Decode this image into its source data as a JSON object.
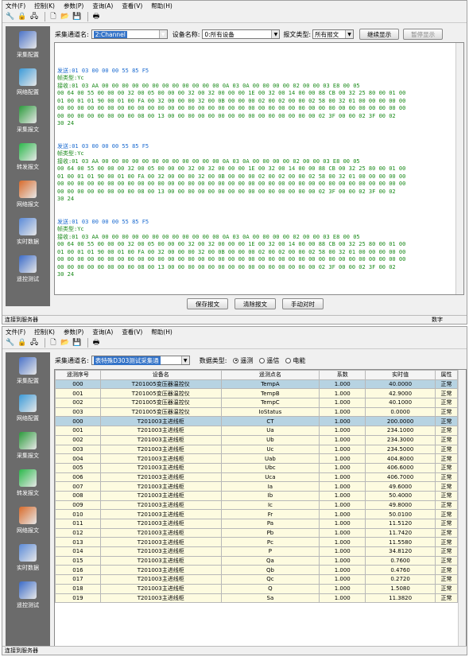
{
  "top": {
    "menu": [
      "文件(F)",
      "控制(K)",
      "参数(P)",
      "查询(A)",
      "查看(V)",
      "帮助(H)"
    ],
    "nav": [
      {
        "label": "采集配置",
        "icon": "config-icon",
        "color": "#4a72c8"
      },
      {
        "label": "网络配置",
        "icon": "network-config-icon",
        "color": "#3a9ad8"
      },
      {
        "label": "采集报文",
        "icon": "collect-message-icon",
        "color": "#2a9a3a"
      },
      {
        "label": "转发报文",
        "icon": "forward-message-icon",
        "color": "#2ab84a"
      },
      {
        "label": "网络报文",
        "icon": "network-message-icon",
        "color": "#d86a2a"
      },
      {
        "label": "实时数据",
        "icon": "realtime-data-icon",
        "color": "#5a8ad8"
      },
      {
        "label": "遥控测试",
        "icon": "remote-test-icon",
        "color": "#3a6ac8"
      }
    ],
    "channel_label": "采集通道名:",
    "channel_value": "2:Channel",
    "device_label": "设备名称:",
    "device_value": "0:所有设备",
    "type_label": "报文类型:",
    "type_value": "所有报文",
    "continue_btn": "继续显示",
    "pause_btn": "暂停显示",
    "log": [
      {
        "sent": "发送:01 03 00 00 00 55 85 F5",
        "frame": "帧类型:Yc",
        "recv": [
          "接收:01 03 AA 00 00 00 00 00 00 00 00 00 00 00 00 0A 03 0A 00 00 00 00 02 00 00 03 E8 00 05",
          "00 64 00 55 00 00 00 32 00 05 00 00 00 32 00 32 00 00 00 1E 00 32 00 14 00 00 88 CB 00 32 25 80 00 01 00",
          "01 00 01 01 90 00 01 00 FA 00 32 00 00 00 32 00 0B 00 00 00 02 00 02 00 00 02 58 00 32 01 00 00 00 00 00",
          "00 00 00 00 00 00 00 00 00 00 00 00 00 00 00 00 00 00 00 00 00 00 00 00 00 00 00 00 00 00 00 00 00 00 00",
          "00 00 00 00 00 00 00 00 08 00 13 00 00 00 00 00 00 00 00 00 00 00 00 00 00 00 02 3F 00 00 02 3F 00 02",
          "30 24"
        ]
      },
      {
        "sent": "发送:01 03 00 00 00 55 85 F5",
        "frame": "帧类型:Yc",
        "recv": [
          "接收:01 03 AA 00 00 00 00 00 00 00 00 00 00 00 00 0A 03 0A 00 00 00 00 02 00 00 03 E8 00 05",
          "00 64 00 55 00 00 00 32 00 05 00 00 00 32 00 32 00 00 00 1E 00 32 00 14 00 00 88 CB 00 32 25 80 00 01 00",
          "01 00 01 01 90 00 01 00 FA 00 32 00 00 00 32 00 0B 00 00 00 02 00 02 00 00 02 58 00 32 01 00 00 00 00 00",
          "00 00 00 00 00 00 00 00 00 00 00 00 00 00 00 00 00 00 00 00 00 00 00 00 00 00 00 00 00 00 00 00 00 00 00",
          "00 00 00 00 00 00 00 00 08 00 13 00 00 00 00 00 00 00 00 00 00 00 00 00 00 00 02 3F 00 00 02 3F 00 02",
          "30 24"
        ]
      },
      {
        "sent": "发送:01 03 00 00 00 55 85 F5",
        "frame": "帧类型:Yc",
        "recv": [
          "接收:01 03 AA 00 00 00 00 00 00 00 00 00 00 00 00 0A 03 0A 00 00 00 00 02 00 00 03 E8 00 05",
          "00 64 00 55 00 00 00 32 00 05 00 00 00 32 00 32 00 00 00 1E 00 32 00 14 00 00 88 CB 00 32 25 80 00 01 00",
          "01 00 01 01 90 00 01 00 FA 00 32 00 00 00 32 00 0B 00 00 00 02 00 02 00 00 02 58 00 32 01 00 00 00 00 00",
          "00 00 00 00 00 00 00 00 00 00 00 00 00 00 00 00 00 00 00 00 00 00 00 00 00 00 00 00 00 00 00 00 00 00 00",
          "00 00 00 00 00 00 00 00 08 00 13 00 00 00 00 00 00 00 00 00 00 00 00 00 00 00 02 3F 00 00 02 3F 00 02",
          "30 24"
        ]
      }
    ],
    "log_tail": "发送:01 03 00 00 00 55 85 F5",
    "save_btn": "保存报文",
    "clear_btn": "清除报文",
    "time_btn": "手动对时",
    "status": "连接到服务器",
    "status_right": "数字"
  },
  "bottom": {
    "menu": [
      "文件(F)",
      "控制(K)",
      "参数(P)",
      "查询(A)",
      "查看(V)",
      "帮助(H)"
    ],
    "nav": [
      {
        "label": "采集配置",
        "icon": "config-icon",
        "color": "#4a72c8"
      },
      {
        "label": "网络配置",
        "icon": "network-config-icon",
        "color": "#3a9ad8"
      },
      {
        "label": "采集报文",
        "icon": "collect-message-icon",
        "color": "#2a9a3a"
      },
      {
        "label": "转发报文",
        "icon": "forward-message-icon",
        "color": "#2ab84a"
      },
      {
        "label": "网络报文",
        "icon": "network-message-icon",
        "color": "#d86a2a"
      },
      {
        "label": "实时数据",
        "icon": "realtime-data-icon",
        "color": "#5a8ad8"
      },
      {
        "label": "遥控测试",
        "icon": "remote-test-icon",
        "color": "#3a6ac8"
      }
    ],
    "channel_label": "采集通道名:",
    "channel_value": "表特殊D303测试采集通",
    "datatype_label": "数据类型:",
    "radios": [
      {
        "label": "遥测",
        "on": true
      },
      {
        "label": "遥信",
        "on": false
      },
      {
        "label": "电能",
        "on": false
      }
    ],
    "columns": [
      "遥测序号",
      "设备名",
      "遥测点名",
      "系数",
      "实时值",
      "属性"
    ],
    "rows": [
      [
        "000",
        "T201005变压器温控仪",
        "TempA",
        "1.000",
        "40.0000",
        "正常"
      ],
      [
        "001",
        "T201005变压器温控仪",
        "TempB",
        "1.000",
        "42.9000",
        "正常"
      ],
      [
        "002",
        "T201005变压器温控仪",
        "TempC",
        "1.000",
        "40.1000",
        "正常"
      ],
      [
        "003",
        "T201005变压器温控仪",
        "IoStatus",
        "1.000",
        "0.0000",
        "正常"
      ],
      [
        "000",
        "T201003主进线柜",
        "CT",
        "1.000",
        "200.0000",
        "正常"
      ],
      [
        "001",
        "T201003主进线柜",
        "Ua",
        "1.000",
        "234.1000",
        "正常"
      ],
      [
        "002",
        "T201003主进线柜",
        "Ub",
        "1.000",
        "234.3000",
        "正常"
      ],
      [
        "003",
        "T201003主进线柜",
        "Uc",
        "1.000",
        "234.5000",
        "正常"
      ],
      [
        "004",
        "T201003主进线柜",
        "Uab",
        "1.000",
        "404.8000",
        "正常"
      ],
      [
        "005",
        "T201003主进线柜",
        "Ubc",
        "1.000",
        "406.6000",
        "正常"
      ],
      [
        "006",
        "T201003主进线柜",
        "Uca",
        "1.000",
        "406.7000",
        "正常"
      ],
      [
        "007",
        "T201003主进线柜",
        "Ia",
        "1.000",
        "49.6000",
        "正常"
      ],
      [
        "008",
        "T201003主进线柜",
        "Ib",
        "1.000",
        "50.4000",
        "正常"
      ],
      [
        "009",
        "T201003主进线柜",
        "Ic",
        "1.000",
        "49.8000",
        "正常"
      ],
      [
        "010",
        "T201003主进线柜",
        "Fr",
        "1.000",
        "50.0100",
        "正常"
      ],
      [
        "011",
        "T201003主进线柜",
        "Pa",
        "1.000",
        "11.5120",
        "正常"
      ],
      [
        "012",
        "T201003主进线柜",
        "Pb",
        "1.000",
        "11.7420",
        "正常"
      ],
      [
        "013",
        "T201003主进线柜",
        "Pc",
        "1.000",
        "11.5580",
        "正常"
      ],
      [
        "014",
        "T201003主进线柜",
        "P",
        "1.000",
        "34.8120",
        "正常"
      ],
      [
        "015",
        "T201003主进线柜",
        "Qa",
        "1.000",
        "0.7600",
        "正常"
      ],
      [
        "016",
        "T201003主进线柜",
        "Qb",
        "1.000",
        "0.4760",
        "正常"
      ],
      [
        "017",
        "T201003主进线柜",
        "Qc",
        "1.000",
        "0.2720",
        "正常"
      ],
      [
        "018",
        "T201003主进线柜",
        "Q",
        "1.000",
        "1.5080",
        "正常"
      ],
      [
        "019",
        "T201003主进线柜",
        "Sa",
        "1.000",
        "11.3820",
        "正常"
      ]
    ],
    "selected_rows": [
      0,
      4
    ],
    "status": "连接到服务器"
  }
}
